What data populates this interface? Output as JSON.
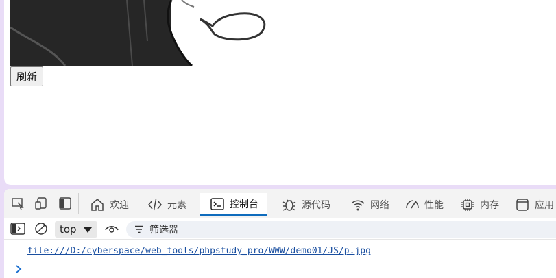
{
  "page": {
    "refresh_label": "刷新"
  },
  "devtools": {
    "tabs": [
      {
        "label": "欢迎",
        "icon": "home-icon"
      },
      {
        "label": "元素",
        "icon": "code-icon"
      },
      {
        "label": "控制台",
        "icon": "console-icon",
        "active": true
      },
      {
        "label": "源代码",
        "icon": "bug-icon"
      },
      {
        "label": "网络",
        "icon": "wifi-icon"
      },
      {
        "label": "性能",
        "icon": "gauge-icon"
      },
      {
        "label": "内存",
        "icon": "chip-icon"
      },
      {
        "label": "应用",
        "icon": "app-icon"
      }
    ],
    "context": "top",
    "filter_placeholder": "筛选器",
    "log_url": "file:///D:/cyberspace/web_tools/phpstudy_pro/WWW/demo01/JS/p.jpg",
    "accent_color": "#0f6cbd"
  }
}
